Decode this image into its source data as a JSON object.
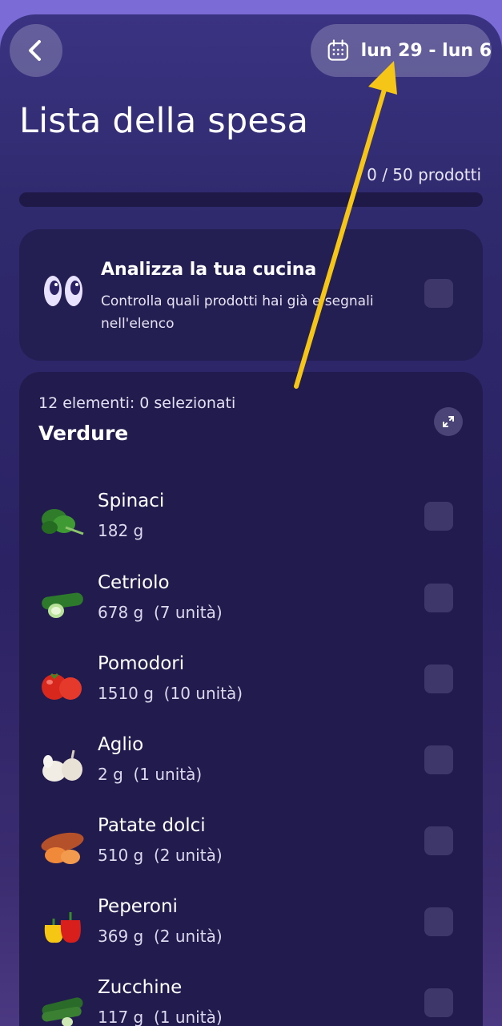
{
  "header": {
    "back_icon": "chevron-left-icon",
    "date_icon": "calendar-icon",
    "date_range": "lun 29 - lun 6"
  },
  "page": {
    "title": "Lista della spesa",
    "product_count": "0 / 50 prodotti",
    "progress_fraction": 0
  },
  "analyze_card": {
    "icon": "eyes-icon",
    "title": "Analizza la tua cucina",
    "description": "Controlla quali prodotti hai già e segnali nell'elenco",
    "checked": false
  },
  "category": {
    "meta": "12 elementi: 0 selezionati",
    "name": "Verdure",
    "expand_icon": "expand-icon",
    "items": [
      {
        "name": "Spinaci",
        "qty": "182 g",
        "icon": "spinach-icon"
      },
      {
        "name": "Cetriolo",
        "qty": "678 g  (7 unità)",
        "icon": "cucumber-icon"
      },
      {
        "name": "Pomodori",
        "qty": "1510 g  (10 unità)",
        "icon": "tomato-icon"
      },
      {
        "name": "Aglio",
        "qty": "2 g  (1 unità)",
        "icon": "garlic-icon"
      },
      {
        "name": "Patate dolci",
        "qty": "510 g  (2 unità)",
        "icon": "sweet-potato-icon"
      },
      {
        "name": "Peperoni",
        "qty": "369 g  (2 unità)",
        "icon": "pepper-icon"
      },
      {
        "name": "Zucchine",
        "qty": "117 g  (1 unità)",
        "icon": "zucchini-icon"
      }
    ]
  },
  "colors": {
    "accent_arrow": "#f5c518",
    "background": "#2a2263",
    "card": "#221c4e"
  }
}
